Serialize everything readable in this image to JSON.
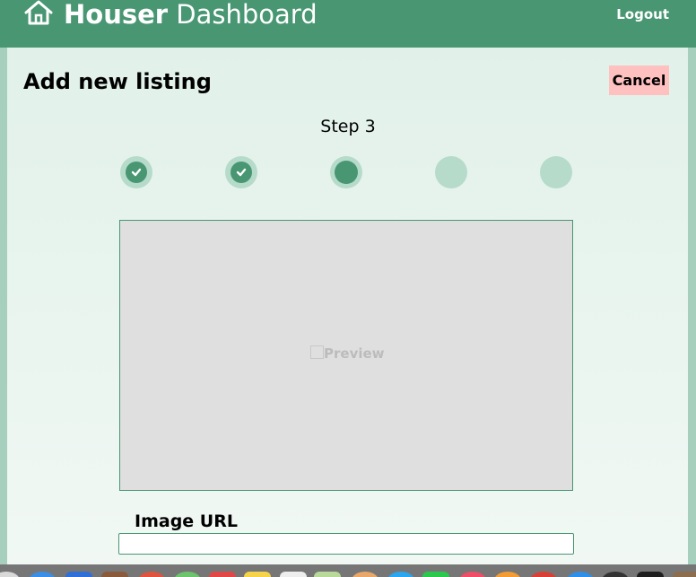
{
  "header": {
    "title_bold": "Houser",
    "title_rest": "Dashboard",
    "logout_label": "Logout",
    "icon": "house-icon",
    "color": "#489672"
  },
  "main": {
    "title": "Add new listing",
    "cancel_label": "Cancel",
    "step_label": "Step 3",
    "steps": [
      {
        "status": "complete",
        "icon": "check-icon"
      },
      {
        "status": "complete",
        "icon": "check-icon"
      },
      {
        "status": "current"
      },
      {
        "status": "upcoming"
      },
      {
        "status": "upcoming"
      }
    ],
    "current_step": 3,
    "total_steps": 5,
    "preview": {
      "alt_text": "Preview",
      "icon": "broken-image-icon"
    },
    "image_url": {
      "label": "Image URL",
      "value": "",
      "placeholder": ""
    }
  },
  "colors": {
    "accent": "#489672",
    "accent_light": "#b6dbcb",
    "cancel": "#ffc0c0",
    "preview_bg": "#dfdfdf"
  },
  "dock": {
    "icons": [
      "finder-icon",
      "safari-icon",
      "mail-icon",
      "app-icon",
      "chrome-icon",
      "maps-icon",
      "calendar-icon",
      "notes-icon",
      "reminders-icon",
      "preview-icon",
      "photos-icon",
      "appstore-icon",
      "messages-icon",
      "itunes-icon",
      "ibooks-icon",
      "app-icon",
      "app-icon",
      "app-icon",
      "clock-icon",
      "terminal-icon",
      "app-icon"
    ]
  }
}
